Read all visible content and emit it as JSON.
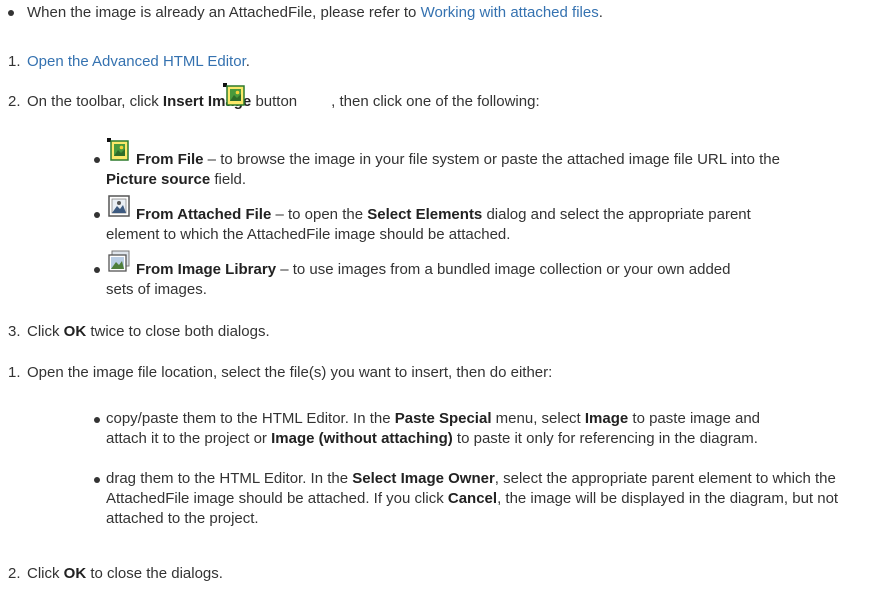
{
  "top_bullet": {
    "text": "When the image is already an AttachedFile, please refer to ",
    "link": "Working with attached files",
    "end": "."
  },
  "list1": {
    "step1": {
      "num": "1.",
      "link": "Open the Advanced HTML Editor",
      "end": "."
    },
    "step2": {
      "num": "2.",
      "pre": "On the toolbar, click ",
      "bold": "Insert Image",
      "mid": " button",
      "post": ", then click one of the following:"
    },
    "options": [
      {
        "icon": "insert-image-icon",
        "title": "From File",
        "pre": " – to browse the image in your file system or paste the attached image file URL into the ",
        "bold": "Picture source",
        "post": " field."
      },
      {
        "icon": "attached-file-image-icon",
        "title": "From Attached File",
        "pre": " – to open the ",
        "bold": "Select Elements",
        "post": " dialog and select the appropriate parent element to which the AttachedFile image should be attached."
      },
      {
        "icon": "image-library-icon",
        "title": "From Image Library",
        "pre": " – to use images from a bundled image collection or your own added sets of images.",
        "bold": "",
        "post": ""
      }
    ],
    "step3": {
      "num": "3.",
      "pre": "Click ",
      "bold": "OK",
      "post": " twice to close both dialogs."
    }
  },
  "list2": {
    "step1": {
      "num": "1.",
      "text": "Open the image file location, select the file(s) you want to insert, then do either:"
    },
    "sub1": {
      "a": "copy/paste them to the HTML Editor. In the ",
      "b": "Paste Special",
      "c": " menu, select ",
      "d": "Image",
      "e": " to paste image and attach it to the project or ",
      "f": "Image (without attaching)",
      "g": " to paste it only for referencing in the diagram."
    },
    "sub2": {
      "a": "drag them to the HTML Editor. In the ",
      "b": "Select Image Owner",
      "c": ", select the appropriate parent element to which the AttachedFile image should be attached. If you click ",
      "d": "Cancel",
      "e": ", the image will be displayed in the diagram, but not attached to the project."
    },
    "step2": {
      "num": "2.",
      "pre": "Click ",
      "bold": "OK",
      "post": " to close the dialogs."
    }
  }
}
